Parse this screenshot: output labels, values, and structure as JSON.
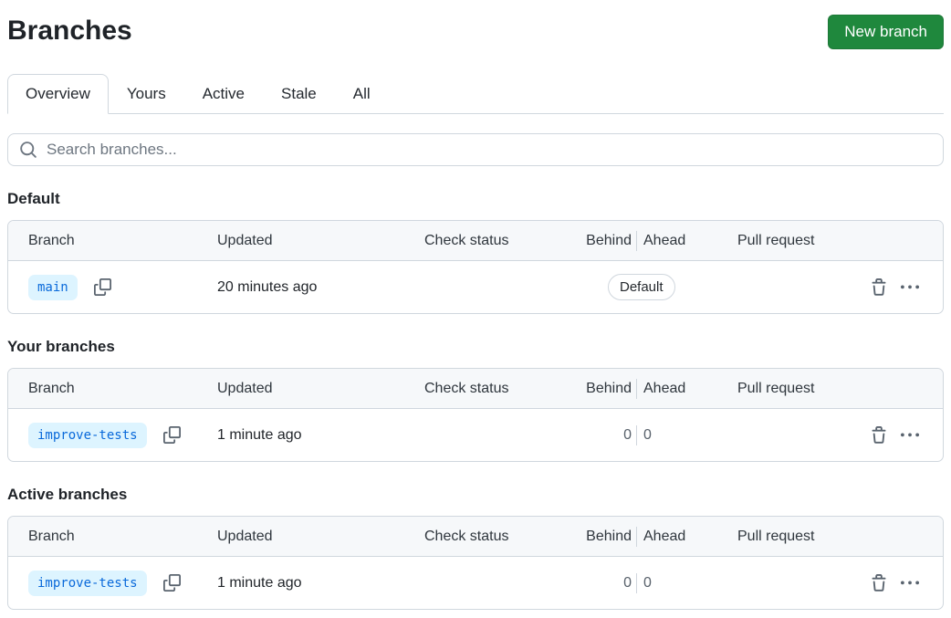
{
  "page": {
    "title": "Branches"
  },
  "header": {
    "new_branch_label": "New branch"
  },
  "tabs": [
    {
      "label": "Overview",
      "active": true
    },
    {
      "label": "Yours",
      "active": false
    },
    {
      "label": "Active",
      "active": false
    },
    {
      "label": "Stale",
      "active": false
    },
    {
      "label": "All",
      "active": false
    }
  ],
  "search": {
    "placeholder": "Search branches...",
    "icon": "search-icon"
  },
  "columns": [
    "Branch",
    "Updated",
    "Check status",
    "Behind",
    "Ahead",
    "Pull request"
  ],
  "sections": [
    {
      "heading": "Default",
      "rows": [
        {
          "branch": "main",
          "updated": "20 minutes ago",
          "check_status": "",
          "status_badge": "Default",
          "pull_request": ""
        }
      ]
    },
    {
      "heading": "Your branches",
      "rows": [
        {
          "branch": "improve-tests",
          "updated": "1 minute ago",
          "check_status": "",
          "behind": "0",
          "ahead": "0",
          "pull_request": ""
        }
      ]
    },
    {
      "heading": "Active branches",
      "rows": [
        {
          "branch": "improve-tests",
          "updated": "1 minute ago",
          "check_status": "",
          "behind": "0",
          "ahead": "0",
          "pull_request": ""
        }
      ]
    }
  ],
  "icons": {
    "search": "magnifier",
    "copy": "copy-overlapping-squares",
    "trash": "trash-can",
    "more": "kebab-horizontal-ellipsis"
  },
  "colors": {
    "primary_button": "#1f883d",
    "branch_badge_bg": "#ddf4ff",
    "branch_badge_text": "#0969da",
    "border": "#d0d7de",
    "table_header_bg": "#f6f8fa",
    "muted_text": "#57606a"
  }
}
